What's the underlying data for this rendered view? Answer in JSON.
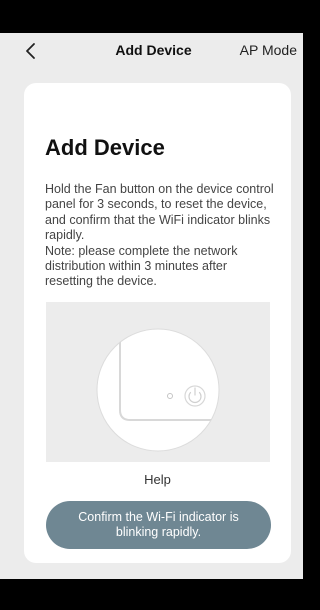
{
  "nav": {
    "back_icon": "chevron-left-icon",
    "title": "Add Device",
    "mode": "AP Mode"
  },
  "card": {
    "title": "Add Device",
    "description": "Hold the Fan button on the device control panel for 3 seconds, to reset the device, and confirm that the WiFi indicator blinks rapidly.\nNote: please complete the network distribution within 3 minutes after resetting the device.",
    "illustration_icon": "device-power-button-icon",
    "help_label": "Help",
    "confirm_label": "Confirm the Wi-Fi indicator is blinking rapidly."
  },
  "colors": {
    "background": "#ececec",
    "card": "#ffffff",
    "button": "#6f8793",
    "frame": "#000000"
  }
}
